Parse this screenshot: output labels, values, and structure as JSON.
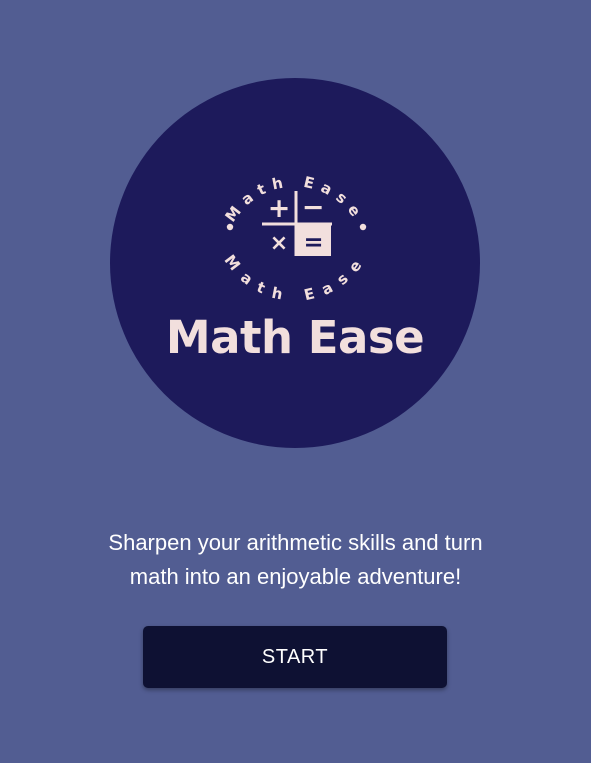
{
  "logo": {
    "ring_text": "Math Ease",
    "symbols": {
      "plus": "+",
      "minus": "−",
      "times": "×",
      "equals": "="
    },
    "name": "Math Ease"
  },
  "tagline": {
    "line1": "Sharpen your arithmetic skills and turn",
    "line2": "math into an enjoyable adventure!"
  },
  "start_button": {
    "label": "START"
  },
  "colors": {
    "background": "#525d92",
    "logo_circle": "#1d1a5b",
    "logo_text": "#f2dfdd",
    "button": "#0e1133",
    "button_text": "#ffffff"
  }
}
